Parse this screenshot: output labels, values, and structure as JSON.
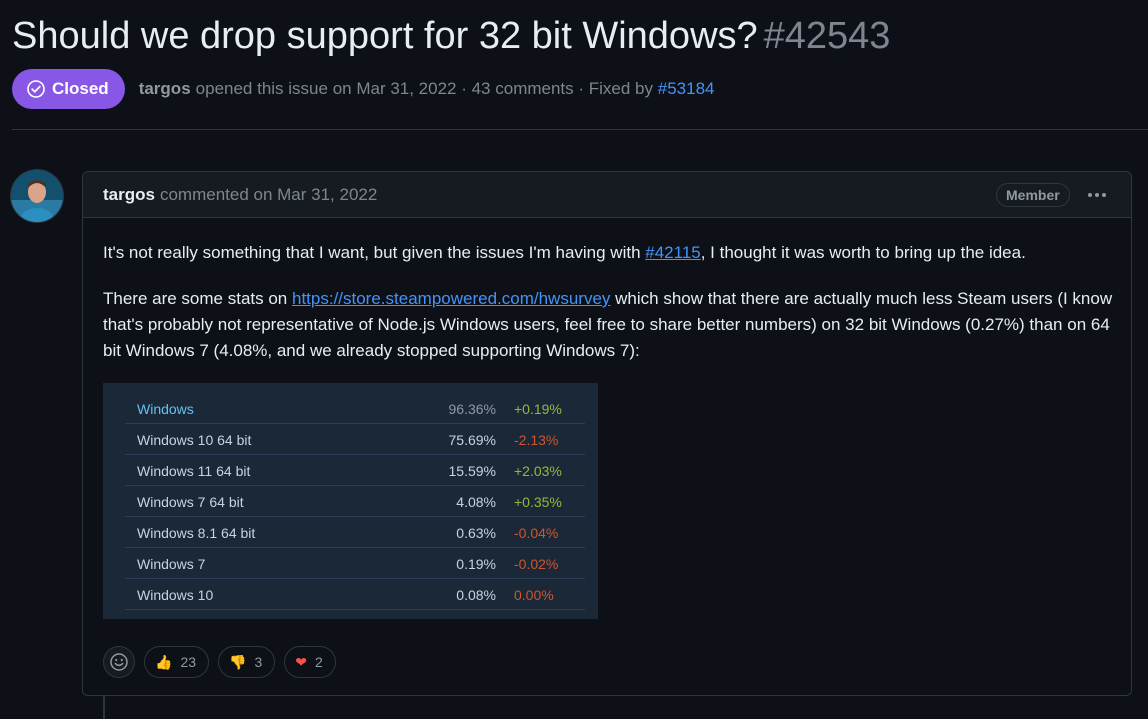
{
  "issue": {
    "title": "Should we drop support for 32 bit Windows?",
    "number": "#42543",
    "state": "Closed",
    "author": "targos",
    "meta_text": "opened this issue on Mar 31, 2022 · 43 comments · Fixed by",
    "fixed_by": "#53184"
  },
  "comment": {
    "author": "targos",
    "timestamp": "commented on Mar 31, 2022",
    "role_badge": "Member",
    "p1_before": "It's not really something that I want, but given the issues I'm having with ",
    "p1_link": "#42115",
    "p1_after": ", I thought it was worth to bring up the idea.",
    "p2_before": "There are some stats on ",
    "p2_link": "https://store.steampowered.com/hwsurvey",
    "p2_after": " which show that there are actually much less Steam users (I know that's probably not representative of Node.js Windows users, feel free to share better numbers) on 32 bit Windows (0.27%) than on 64 bit Windows 7 (4.08%, and we already stopped supporting Windows 7):"
  },
  "stats_image": {
    "rows": [
      {
        "name": "Windows",
        "pct": "96.36%",
        "change": "+0.19%",
        "trend": "pos"
      },
      {
        "name": "Windows 10 64 bit",
        "pct": "75.69%",
        "change": "-2.13%",
        "trend": "neg"
      },
      {
        "name": "Windows 11 64 bit",
        "pct": "15.59%",
        "change": "+2.03%",
        "trend": "pos"
      },
      {
        "name": "Windows 7 64 bit",
        "pct": "4.08%",
        "change": "+0.35%",
        "trend": "pos"
      },
      {
        "name": "Windows 8.1 64 bit",
        "pct": "0.63%",
        "change": "-0.04%",
        "trend": "neg"
      },
      {
        "name": "Windows 7",
        "pct": "0.19%",
        "change": "-0.02%",
        "trend": "neg"
      },
      {
        "name": "Windows 10",
        "pct": "0.08%",
        "change": "0.00%",
        "trend": "neg"
      }
    ]
  },
  "reactions": [
    {
      "icon": "thumbs-up-icon",
      "emoji": "👍",
      "count": "23"
    },
    {
      "icon": "thumbs-down-icon",
      "emoji": "👎",
      "count": "3"
    },
    {
      "icon": "heart-icon",
      "emoji": "❤",
      "count": "2"
    }
  ],
  "colors": {
    "closed_badge": "#8957e5",
    "link": "#4493f8",
    "background": "#0d1117"
  }
}
